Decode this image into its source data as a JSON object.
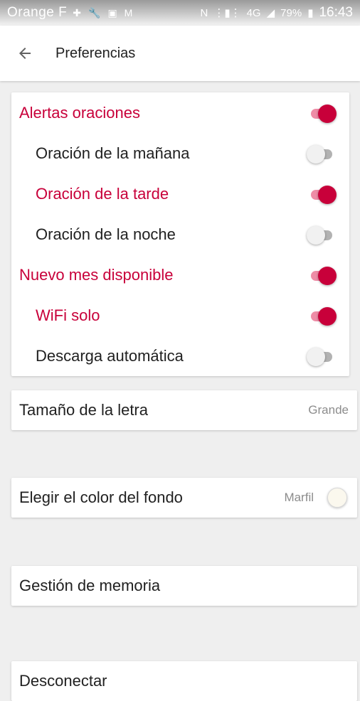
{
  "status_bar": {
    "carrier": "Orange F",
    "network": "4G",
    "battery": "79%",
    "time": "16:43"
  },
  "toolbar": {
    "back_icon": "arrow-back-icon",
    "title": "Preferencias"
  },
  "alerts": {
    "items": [
      {
        "label": "Alertas oraciones",
        "on": true
      },
      {
        "label": "Oración de la mañana",
        "on": false
      },
      {
        "label": "Oración de la tarde",
        "on": true
      },
      {
        "label": "Oración de la noche",
        "on": false
      },
      {
        "label": "Nuevo mes disponible",
        "on": true
      },
      {
        "label": "WiFi solo",
        "on": true
      },
      {
        "label": "Descarga automática",
        "on": false
      }
    ]
  },
  "settings": {
    "font_size": {
      "label": "Tamaño de la letra",
      "value": "Grande"
    },
    "background_color": {
      "label": "Elegir el color del fondo",
      "value": "Marfil",
      "swatch": "#fbf8ee"
    },
    "memory": {
      "label": "Gestión de memoria"
    },
    "logout": {
      "label": "Desconectar"
    }
  },
  "colors": {
    "accent": "#c8003a",
    "accent_track": "#ee8ca6",
    "background": "#efefef"
  }
}
